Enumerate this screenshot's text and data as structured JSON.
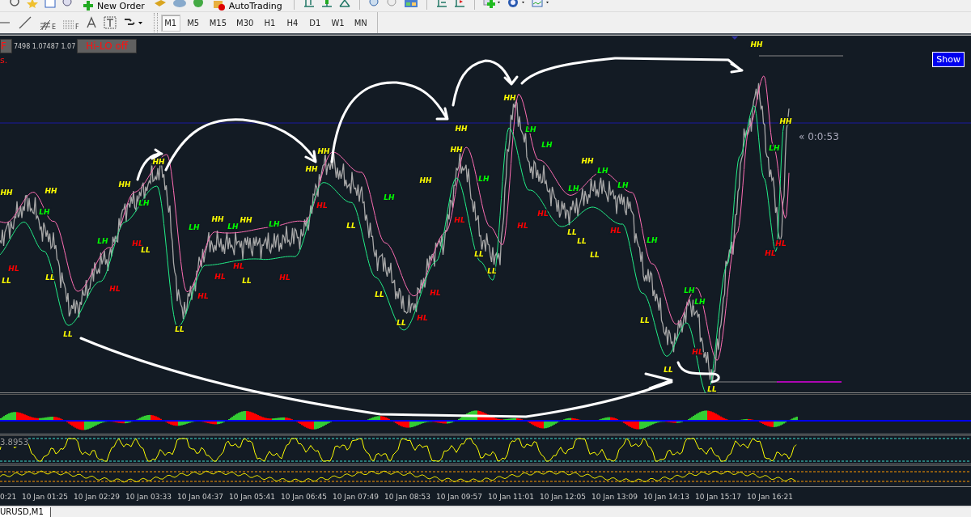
{
  "toolbar": {
    "buttons": [
      {
        "label": "New Order"
      },
      {
        "label": "AutoTrading"
      }
    ]
  },
  "drawing_tools": [
    {
      "subscript": "E"
    },
    {
      "subscript": "F"
    }
  ],
  "timeframes": [
    {
      "label": "M1",
      "selected": true
    },
    {
      "label": "M5",
      "selected": false
    },
    {
      "label": "M15",
      "selected": false
    },
    {
      "label": "M30",
      "selected": false
    },
    {
      "label": "H1",
      "selected": false
    },
    {
      "label": "H4",
      "selected": false
    },
    {
      "label": "D1",
      "selected": false
    },
    {
      "label": "W1",
      "selected": false
    },
    {
      "label": "MN",
      "selected": false
    }
  ],
  "chart": {
    "symbol_box": "F",
    "quote": "7498 1.07487 1.07",
    "hilo_button": "Hi-LO off",
    "status_text": "s.",
    "show_button": "Show",
    "countdown": "« 0:0:53",
    "markers": [
      {
        "label": "HH",
        "color": "#ffff00"
      },
      {
        "label": "HH",
        "color": "#ffff00"
      },
      {
        "label": "HH",
        "color": "#ffff00"
      },
      {
        "label": "HH",
        "color": "#ffff00"
      },
      {
        "label": "HH",
        "color": "#ffff00"
      },
      {
        "label": "HH",
        "color": "#ffff00"
      },
      {
        "label": "HH",
        "color": "#ffff00"
      },
      {
        "label": "HH",
        "color": "#ffff00"
      },
      {
        "label": "HH",
        "color": "#ffff00"
      },
      {
        "label": "HH",
        "color": "#ffff00"
      },
      {
        "label": "HH",
        "color": "#ffff00"
      },
      {
        "label": "HH",
        "color": "#ffff00"
      },
      {
        "label": "HH",
        "color": "#ffff00"
      },
      {
        "label": "HH",
        "color": "#ffff00"
      },
      {
        "label": "HH",
        "color": "#ffff00"
      },
      {
        "label": "LH",
        "color": "#00ff00"
      },
      {
        "label": "LH",
        "color": "#00ff00"
      },
      {
        "label": "LH",
        "color": "#00ff00"
      },
      {
        "label": "LH",
        "color": "#00ff00"
      },
      {
        "label": "LH",
        "color": "#00ff00"
      },
      {
        "label": "LH",
        "color": "#00ff00"
      },
      {
        "label": "LH",
        "color": "#00ff00"
      },
      {
        "label": "LH",
        "color": "#00ff00"
      },
      {
        "label": "LH",
        "color": "#00ff00"
      },
      {
        "label": "LH",
        "color": "#00ff00"
      },
      {
        "label": "LH",
        "color": "#00ff00"
      },
      {
        "label": "LH",
        "color": "#00ff00"
      },
      {
        "label": "LH",
        "color": "#00ff00"
      },
      {
        "label": "LH",
        "color": "#00ff00"
      },
      {
        "label": "LH",
        "color": "#00ff00"
      },
      {
        "label": "LH",
        "color": "#00ff00"
      },
      {
        "label": "LH",
        "color": "#00ff00"
      },
      {
        "label": "HL",
        "color": "#ff0000"
      },
      {
        "label": "HL",
        "color": "#ff0000"
      },
      {
        "label": "HL",
        "color": "#ff0000"
      },
      {
        "label": "HL",
        "color": "#ff0000"
      },
      {
        "label": "HL",
        "color": "#ff0000"
      },
      {
        "label": "HL",
        "color": "#ff0000"
      },
      {
        "label": "HL",
        "color": "#ff0000"
      },
      {
        "label": "HL",
        "color": "#ff0000"
      },
      {
        "label": "HL",
        "color": "#ff0000"
      },
      {
        "label": "HL",
        "color": "#ff0000"
      },
      {
        "label": "HL",
        "color": "#ff0000"
      },
      {
        "label": "HL",
        "color": "#ff0000"
      },
      {
        "label": "HL",
        "color": "#ff0000"
      },
      {
        "label": "HL",
        "color": "#ff0000"
      },
      {
        "label": "HL",
        "color": "#ff0000"
      },
      {
        "label": "HL",
        "color": "#ff0000"
      },
      {
        "label": "HL",
        "color": "#ff0000"
      },
      {
        "label": "LL",
        "color": "#ffff00"
      },
      {
        "label": "LL",
        "color": "#ffff00"
      },
      {
        "label": "LL",
        "color": "#ffff00"
      },
      {
        "label": "LL",
        "color": "#ffff00"
      },
      {
        "label": "LL",
        "color": "#ffff00"
      },
      {
        "label": "LL",
        "color": "#ffff00"
      },
      {
        "label": "LL",
        "color": "#ffff00"
      },
      {
        "label": "LL",
        "color": "#ffff00"
      },
      {
        "label": "LL",
        "color": "#ffff00"
      },
      {
        "label": "LL",
        "color": "#ffff00"
      },
      {
        "label": "LL",
        "color": "#ffff00"
      },
      {
        "label": "LL",
        "color": "#ffff00"
      },
      {
        "label": "LL",
        "color": "#ffff00"
      },
      {
        "label": "LL",
        "color": "#ffff00"
      },
      {
        "label": "LL",
        "color": "#ffff00"
      },
      {
        "label": "LL",
        "color": "#ffff00"
      },
      {
        "label": "LL",
        "color": "#ffff00"
      }
    ]
  },
  "oscillator": {
    "reading": "3.8953"
  },
  "time_axis": [
    "0:21",
    "10 Jan 01:25",
    "10 Jan 02:29",
    "10 Jan 03:33",
    "10 Jan 04:37",
    "10 Jan 05:41",
    "10 Jan 06:45",
    "10 Jan 07:49",
    "10 Jan 08:53",
    "10 Jan 09:57",
    "10 Jan 11:01",
    "10 Jan 12:05",
    "10 Jan 13:09",
    "10 Jan 14:13",
    "10 Jan 15:17",
    "10 Jan 16:21"
  ],
  "tab": {
    "label": "URUSD,M1",
    "selected": true
  }
}
